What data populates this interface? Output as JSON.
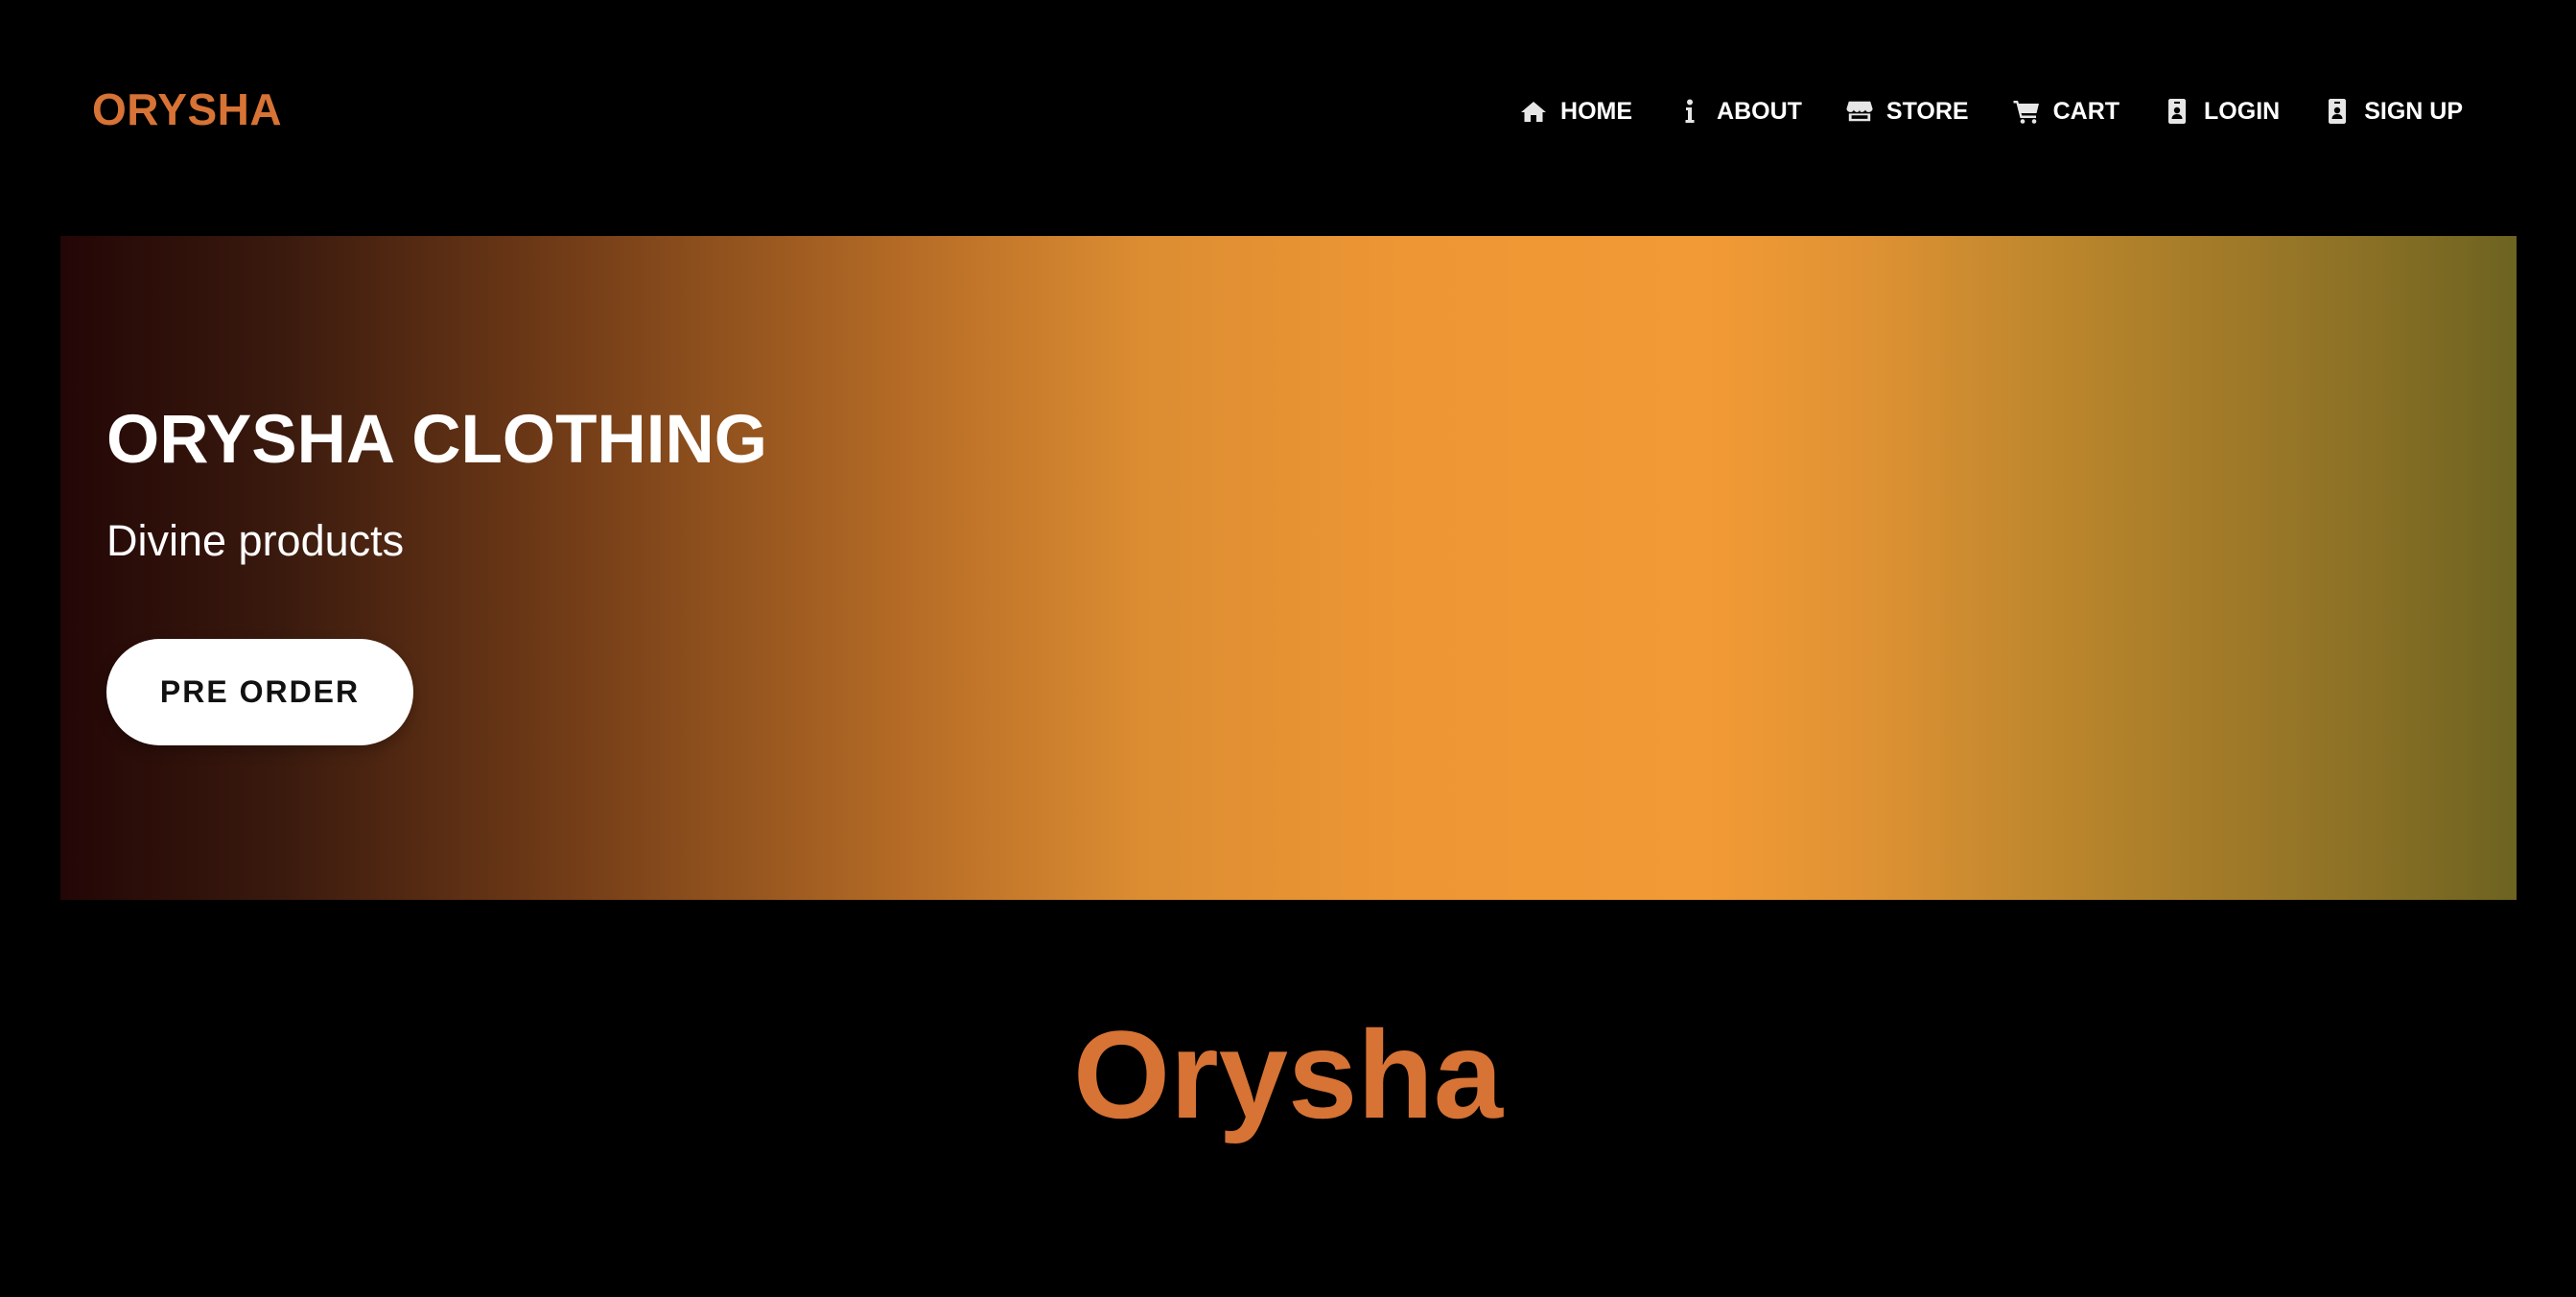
{
  "header": {
    "brand": "ORYSHA",
    "nav": [
      {
        "label": "HOME",
        "icon": "home-icon"
      },
      {
        "label": "ABOUT",
        "icon": "info-icon"
      },
      {
        "label": "STORE",
        "icon": "store-icon"
      },
      {
        "label": "CART",
        "icon": "cart-icon"
      },
      {
        "label": "LOGIN",
        "icon": "id-badge-icon"
      },
      {
        "label": "SIGN UP",
        "icon": "id-badge-icon"
      }
    ]
  },
  "hero": {
    "title": "ORYSHA CLOTHING",
    "subtitle": "Divine products",
    "cta_label": "PRE ORDER"
  },
  "section": {
    "title": "Orysha"
  },
  "colors": {
    "background": "#000000",
    "accent": "#d67335",
    "text": "#ffffff",
    "gradient_left": "#230606",
    "gradient_center": "#f29a35",
    "gradient_right": "#6d6321"
  }
}
